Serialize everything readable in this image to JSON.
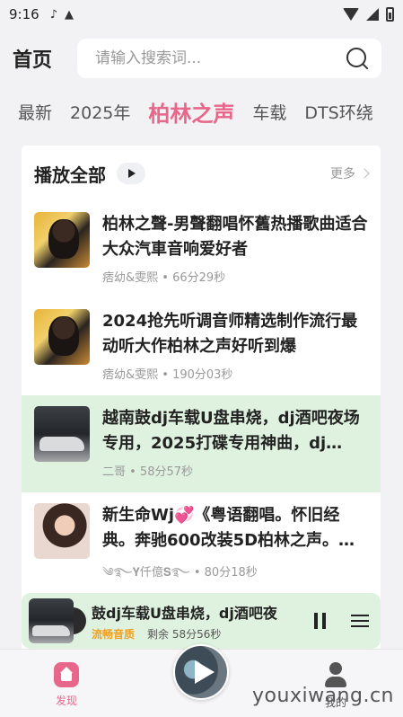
{
  "status_bar": {
    "time": "9:16",
    "app_icon_1": "tiktok-icon",
    "app_icon_2": "a-icon"
  },
  "header": {
    "title": "首页",
    "search_placeholder": "请输入搜索词..."
  },
  "tabs": [
    {
      "label": "最新"
    },
    {
      "label": "2025年"
    },
    {
      "label": "柏林之声",
      "active": true
    },
    {
      "label": "车载"
    },
    {
      "label": "DTS环绕"
    }
  ],
  "section": {
    "title": "播放全部",
    "more_label": "更多"
  },
  "items": [
    {
      "title": "柏林之聲-男聲翻唱怀舊热播歌曲适合大众汽車音响爱好者",
      "meta": "痞幼&雯熙 • 66分29秒"
    },
    {
      "title": "2024抢先听调音师精选制作流行最动听大作柏林之声好听到爆",
      "meta": "痞幼&雯熙 • 190分03秒"
    },
    {
      "title": "越南鼓dj车载U盘串烧，dj酒吧夜场专用，2025打碟专用神曲，dj…",
      "meta": "二哥 • 58分57秒",
      "playing": true
    },
    {
      "title": "新生命Wj💞《粤语翻唱。怀旧经典。奔驰600改装5D柏林之声。…",
      "meta": "༄࿐𝐘仟億𝐒࿐ • 80分18秒"
    }
  ],
  "player": {
    "title": "鼓dj车载U盘串烧，dj酒吧夜",
    "quality": "流畅音质",
    "remaining": "剩余 58分56秒"
  },
  "bottom_nav": {
    "discover_label": "发现",
    "me_label": "我的"
  },
  "watermark": "youxiwang.cn",
  "colors": {
    "accent": "#e8668a",
    "playing_bg": "#dff2df",
    "quality": "#f0a020"
  }
}
